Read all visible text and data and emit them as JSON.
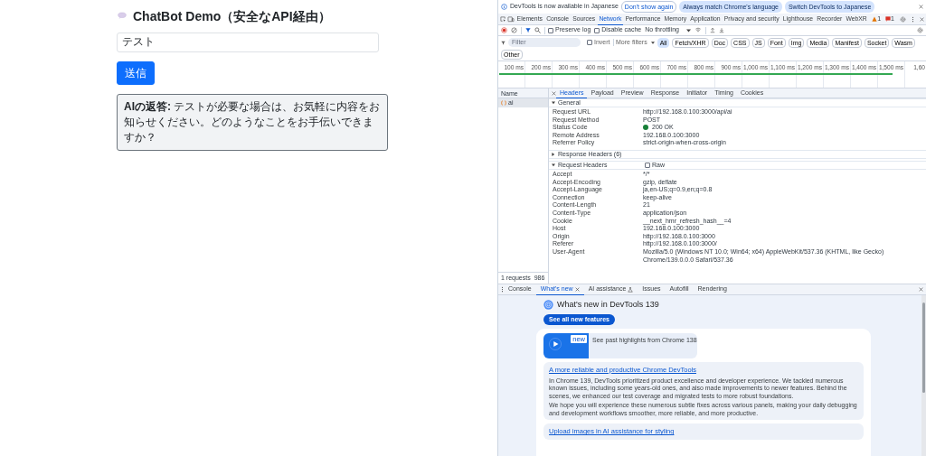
{
  "chat": {
    "title": "ChatBot Demo（安全なAPI経由）",
    "input_value": "テスト",
    "send_button": "送信",
    "reply": "**AIの返答:** テストが必要な場合は、お気軽に内容をお知らせください。どのようなことをお手伝いできますか？"
  },
  "devtools": {
    "infobar": {
      "text": "DevTools is now available in Japanese",
      "buttons": [
        {
          "label": "Don't show again",
          "kind": "outline"
        },
        {
          "label": "Always match Chrome's language",
          "kind": "tonal"
        },
        {
          "label": "Switch DevTools to Japanese",
          "kind": "tonal"
        }
      ]
    },
    "tabs": [
      {
        "label": "Elements",
        "selected": false
      },
      {
        "label": "Console",
        "selected": false
      },
      {
        "label": "Sources",
        "selected": false
      },
      {
        "label": "Network",
        "selected": true
      },
      {
        "label": "Performance",
        "selected": false
      },
      {
        "label": "Memory",
        "selected": false
      },
      {
        "label": "Application",
        "selected": false
      },
      {
        "label": "Privacy and security",
        "selected": false
      },
      {
        "label": "Lighthouse",
        "selected": false
      },
      {
        "label": "Recorder",
        "selected": false
      },
      {
        "label": "WebXR",
        "selected": false
      }
    ],
    "warnings": "1",
    "errors": "1",
    "toolbar": {
      "preserve_log": {
        "label": "Preserve log",
        "checked": false
      },
      "disable_cache": {
        "label": "Disable cache",
        "checked": false
      },
      "throttling": "No throttling"
    },
    "filter": {
      "placeholder": "Filter",
      "invert": {
        "label": "Invert",
        "checked": false
      },
      "more_filters": "More filters",
      "types": [
        {
          "label": "All",
          "selected": true
        },
        {
          "label": "Fetch/XHR",
          "selected": false
        },
        {
          "label": "Doc",
          "selected": false
        },
        {
          "label": "CSS",
          "selected": false
        },
        {
          "label": "JS",
          "selected": false
        },
        {
          "label": "Font",
          "selected": false
        },
        {
          "label": "Img",
          "selected": false
        },
        {
          "label": "Media",
          "selected": false
        },
        {
          "label": "Manifest",
          "selected": false
        },
        {
          "label": "Socket",
          "selected": false
        },
        {
          "label": "Wasm",
          "selected": false
        },
        {
          "label": "Other",
          "selected": false
        }
      ]
    },
    "timeline": {
      "ticks": [
        "100 ms",
        "200 ms",
        "300 ms",
        "400 ms",
        "500 ms",
        "600 ms",
        "700 ms",
        "800 ms",
        "900 ms",
        "1,000 ms",
        "1,100 ms",
        "1,200 ms",
        "1,300 ms",
        "1,400 ms",
        "1,500 ms",
        "1,60"
      ]
    },
    "requests": {
      "column": "Name",
      "rows": [
        {
          "name": "ai",
          "selected": true
        }
      ],
      "summary": [
        "1 requests",
        "986"
      ]
    },
    "details": {
      "tabs": [
        {
          "label": "Headers",
          "selected": true
        },
        {
          "label": "Payload",
          "selected": false
        },
        {
          "label": "Preview",
          "selected": false
        },
        {
          "label": "Response",
          "selected": false
        },
        {
          "label": "Initiator",
          "selected": false
        },
        {
          "label": "Timing",
          "selected": false
        },
        {
          "label": "Cookies",
          "selected": false
        }
      ],
      "sections": [
        {
          "title": "General",
          "expanded": true,
          "rows": [
            {
              "name": "Request URL",
              "value": "http://192.168.0.100:3000/api/ai",
              "kind": "text"
            },
            {
              "name": "Request Method",
              "value": "POST",
              "kind": "text"
            },
            {
              "name": "Status Code",
              "value": "200 OK",
              "kind": "status"
            },
            {
              "name": "Remote Address",
              "value": "192.168.0.100:3000",
              "kind": "text"
            },
            {
              "name": "Referrer Policy",
              "value": "strict-origin-when-cross-origin",
              "kind": "text"
            }
          ]
        },
        {
          "title": "Response Headers (6)",
          "expanded": false
        },
        {
          "title": "Request Headers",
          "expanded": true,
          "raw": {
            "label": "Raw",
            "checked": false
          },
          "rows": [
            {
              "name": "Accept",
              "value": "*/*",
              "kind": "text"
            },
            {
              "name": "Accept-Encoding",
              "value": "gzip, deflate",
              "kind": "text"
            },
            {
              "name": "Accept-Language",
              "value": "ja,en-US;q=0.9,en;q=0.8",
              "kind": "text"
            },
            {
              "name": "Connection",
              "value": "keep-alive",
              "kind": "text"
            },
            {
              "name": "Content-Length",
              "value": "21",
              "kind": "text"
            },
            {
              "name": "Content-Type",
              "value": "application/json",
              "kind": "text"
            },
            {
              "name": "Cookie",
              "value": "__next_hmr_refresh_hash__=4",
              "kind": "text"
            },
            {
              "name": "Host",
              "value": "192.168.0.100:3000",
              "kind": "text"
            },
            {
              "name": "Origin",
              "value": "http://192.168.0.100:3000",
              "kind": "text"
            },
            {
              "name": "Referer",
              "value": "http://192.168.0.100:3000/",
              "kind": "text"
            },
            {
              "name": "User-Agent",
              "value": "Mozilla/5.0 (Windows NT 10.0; Win64; x64) AppleWebKit/537.36 (KHTML, like Gecko) Chrome/139.0.0.0 Safari/537.36",
              "kind": "text"
            }
          ]
        }
      ]
    },
    "drawer": {
      "tabs": [
        {
          "label": "Console",
          "selected": false,
          "closable": false,
          "beta": false
        },
        {
          "label": "What's new",
          "selected": true,
          "closable": true,
          "beta": false
        },
        {
          "label": "AI assistance",
          "selected": false,
          "closable": false,
          "beta": true
        },
        {
          "label": "Issues",
          "selected": false,
          "closable": false,
          "beta": false
        },
        {
          "label": "Autofill",
          "selected": false,
          "closable": false,
          "beta": false
        },
        {
          "label": "Rendering",
          "selected": false,
          "closable": false,
          "beta": false
        }
      ],
      "whats_new": {
        "title": "What's new in DevTools 139",
        "button": "See all new features",
        "video": {
          "badge": "new",
          "caption": "See past highlights from Chrome 138"
        },
        "articles": [
          {
            "title": "A more reliable and productive Chrome DevTools",
            "paragraphs": [
              "In Chrome 139, DevTools prioritized product excellence and developer experience. We tackled numerous known issues, including some years-old ones, and also made improvements to newer features. Behind the scenes, we enhanced our test coverage and migrated tests to more robust foundations.",
              "We hope you will experience these numerous subtle fixes across various panels, making your daily debugging and development workflows smoother, more reliable, and more productive."
            ]
          },
          {
            "title": "Upload images in AI assistance for styling"
          }
        ]
      }
    }
  }
}
